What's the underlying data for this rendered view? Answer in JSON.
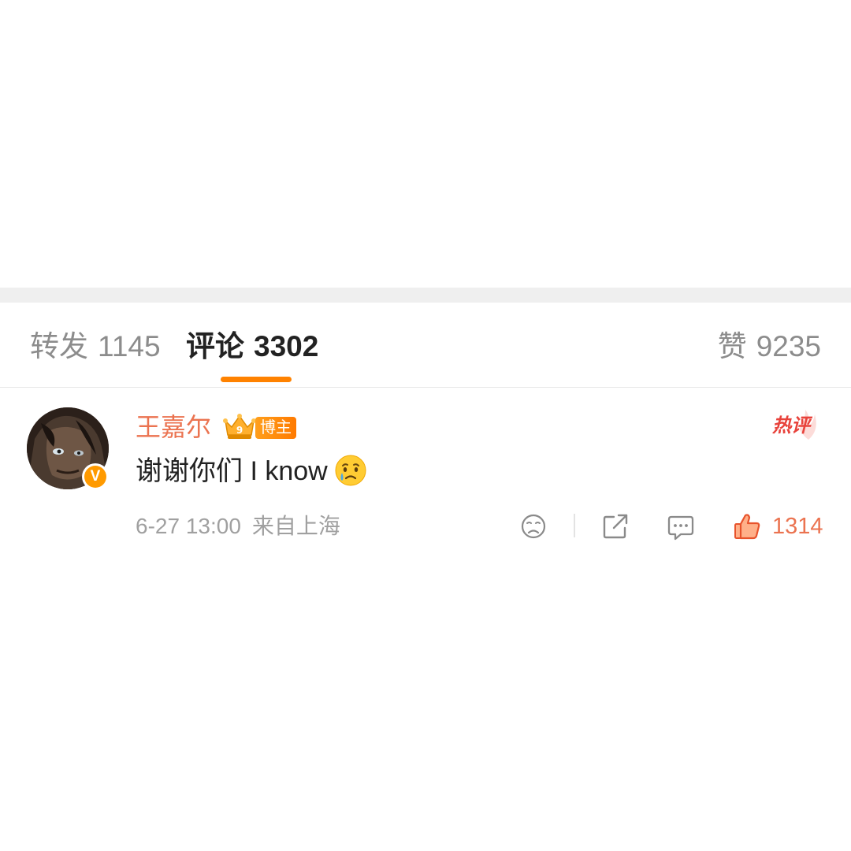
{
  "tabs": {
    "repost": {
      "label": "转发",
      "count": "1145"
    },
    "comments": {
      "label": "评论",
      "count": "3302"
    },
    "likes": {
      "label": "赞",
      "count": "9235"
    }
  },
  "comment": {
    "username": "王嘉尔",
    "role_badge": "博主",
    "crown_level": "9",
    "verified_badge": "V",
    "hot_label": "热评",
    "text": "谢谢你们 I know",
    "emoji": "crying-face",
    "time": "6-27 13:00",
    "location": "来自上海",
    "like_count": "1314"
  },
  "colors": {
    "accent_orange": "#ff8200",
    "username_orange": "#eb7350",
    "hot_red": "#e8423b",
    "muted_gray": "#8c8c8c"
  },
  "icons": [
    "dislike-icon",
    "share-icon",
    "reply-icon",
    "like-icon",
    "crown-icon",
    "verified-icon"
  ]
}
